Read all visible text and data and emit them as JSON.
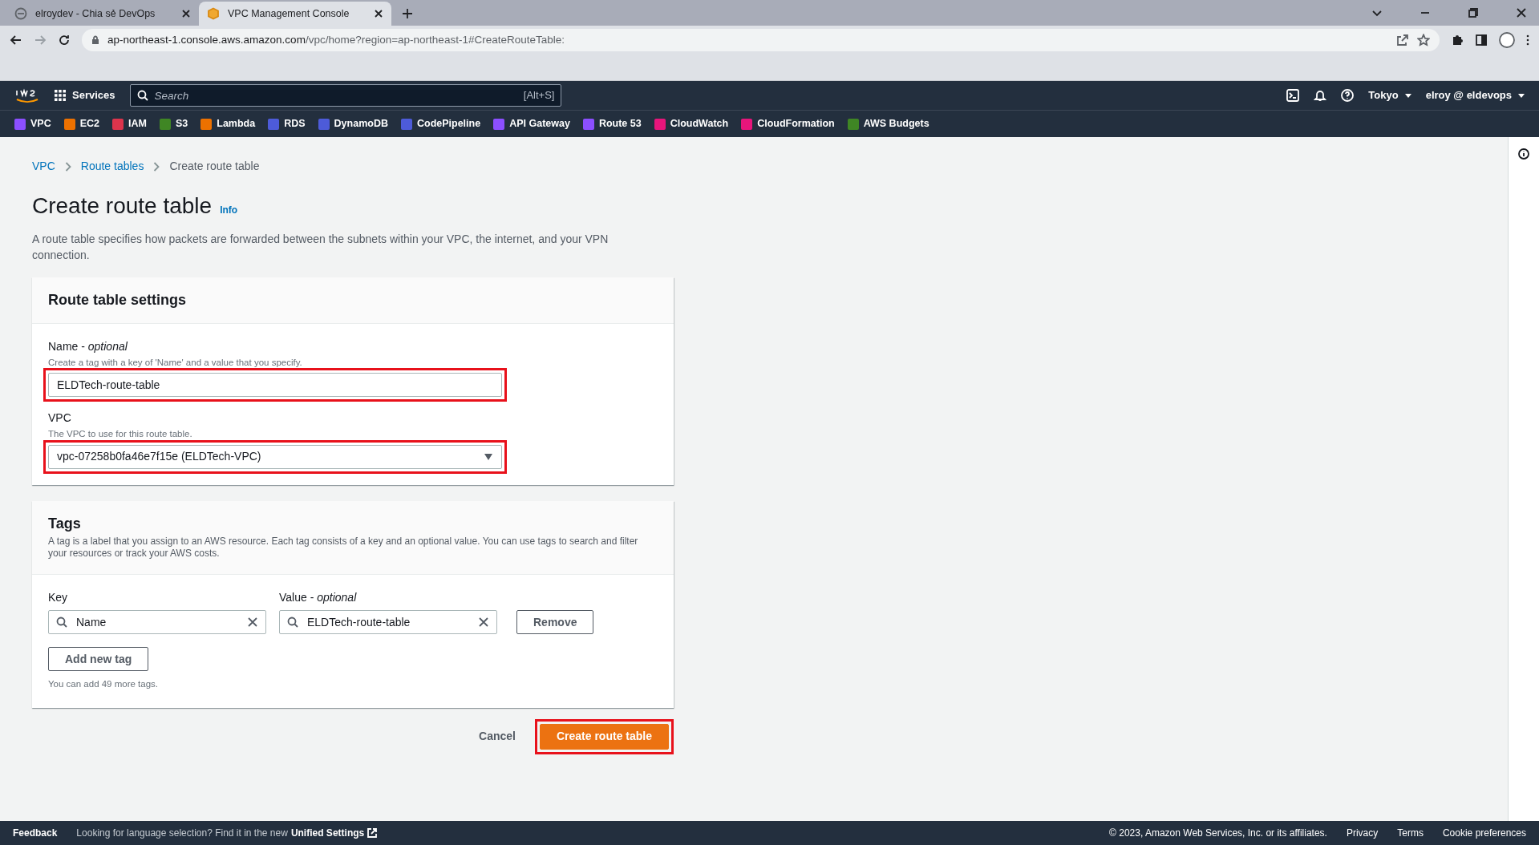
{
  "browser": {
    "tabs": [
      {
        "title": "elroydev - Chia sẻ DevOps",
        "selected": false
      },
      {
        "title": "VPC Management Console",
        "selected": true
      }
    ],
    "url": {
      "host": "ap-northeast-1.console.aws.amazon.com",
      "path": "/vpc/home?region=ap-northeast-1#CreateRouteTable:"
    }
  },
  "header": {
    "services": "Services",
    "search_placeholder": "Search",
    "search_shortcut": "[Alt+S]",
    "region": "Tokyo",
    "account": "elroy @ eldevops"
  },
  "favorites": [
    {
      "label": "VPC",
      "color": "#8c4fff"
    },
    {
      "label": "EC2",
      "color": "#ed7100"
    },
    {
      "label": "IAM",
      "color": "#dd344c"
    },
    {
      "label": "S3",
      "color": "#3f8624"
    },
    {
      "label": "Lambda",
      "color": "#ed7100"
    },
    {
      "label": "RDS",
      "color": "#4d5bd9"
    },
    {
      "label": "DynamoDB",
      "color": "#4d5bd9"
    },
    {
      "label": "CodePipeline",
      "color": "#4d5bd9"
    },
    {
      "label": "API Gateway",
      "color": "#8c4fff"
    },
    {
      "label": "Route 53",
      "color": "#8c4fff"
    },
    {
      "label": "CloudWatch",
      "color": "#e7157b"
    },
    {
      "label": "CloudFormation",
      "color": "#e7157b"
    },
    {
      "label": "AWS Budgets",
      "color": "#3f8624"
    }
  ],
  "breadcrumb": [
    {
      "label": "VPC",
      "link": true
    },
    {
      "label": "Route tables",
      "link": true
    },
    {
      "label": "Create route table",
      "link": false
    }
  ],
  "page": {
    "title": "Create route table",
    "info": "Info",
    "description": "A route table specifies how packets are forwarded between the subnets within your VPC, the internet, and your VPN connection."
  },
  "settings": {
    "title": "Route table settings",
    "fields": [
      {
        "kind": "text",
        "label": "Name - *optional*",
        "hint": "Create a tag with a key of 'Name' and a value that you specify.",
        "value": "ELDTech-route-table",
        "highlighted": true
      },
      {
        "kind": "select",
        "label": "VPC",
        "hint": "The VPC to use for this route table.",
        "value": "vpc-07258b0fa46e7f15e (ELDTech-VPC)",
        "highlighted": true
      }
    ]
  },
  "tags": {
    "title": "Tags",
    "description": "A tag is a label that you assign to an AWS resource. Each tag consists of a key and an optional value. You can use tags to search and filter your resources or track your AWS costs.",
    "key_label": "Key",
    "value_label": "Value - *optional*",
    "rows": [
      {
        "key": "Name",
        "value": "ELDTech-route-table",
        "remove": "Remove"
      }
    ],
    "add": "Add new tag",
    "limit": "You can add 49 more tags."
  },
  "actions": {
    "cancel": "Cancel",
    "create": {
      "label": "Create route table",
      "highlighted": true
    }
  },
  "footer": {
    "feedback": "Feedback",
    "notice": "Looking for language selection? Find it in the new",
    "settings_link": "Unified Settings",
    "copyright": "© 2023, Amazon Web Services, Inc. or its affiliates.",
    "links": [
      "Privacy",
      "Terms",
      "Cookie preferences"
    ]
  }
}
